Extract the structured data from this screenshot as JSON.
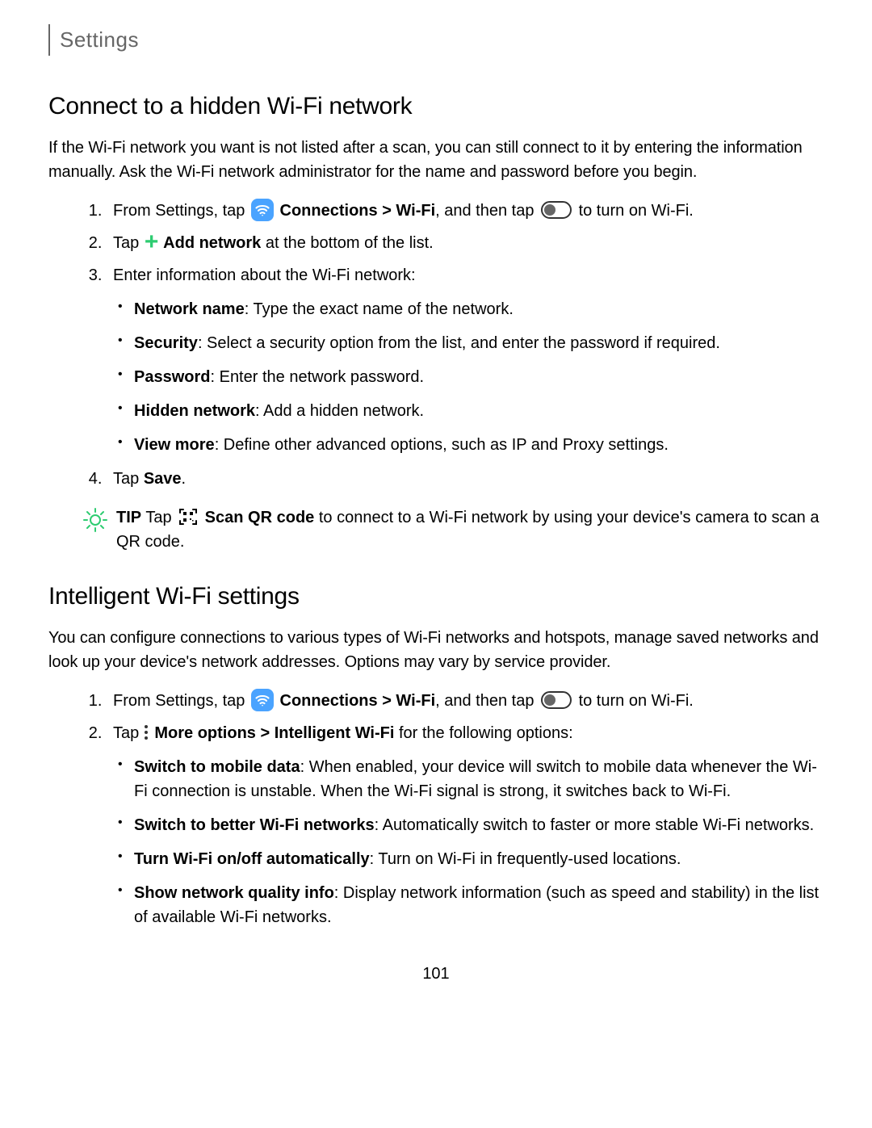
{
  "header": {
    "title": "Settings"
  },
  "section1": {
    "heading": "Connect to a hidden Wi-Fi network",
    "intro": "If the Wi-Fi network you want is not listed after a scan, you can still connect to it by entering the information manually. Ask the Wi-Fi network administrator for the name and password before you begin.",
    "step1_a": "From Settings, tap ",
    "step1_b": " Connections > Wi-Fi",
    "step1_c": ", and then tap ",
    "step1_d": " to turn on Wi-Fi.",
    "step2_a": "Tap ",
    "step2_b": " Add network",
    "step2_c": " at the bottom of the list.",
    "step3": "Enter information about the Wi-Fi network:",
    "bullets": [
      {
        "term": "Network name",
        "desc": ": Type the exact name of the network."
      },
      {
        "term": "Security",
        "desc": ": Select a security option from the list, and enter the password if required."
      },
      {
        "term": "Password",
        "desc": ": Enter the network password."
      },
      {
        "term": "Hidden network",
        "desc": ": Add a hidden network."
      },
      {
        "term": "View more",
        "desc": ": Define other advanced options, such as IP and Proxy settings."
      }
    ],
    "step4_a": "Tap ",
    "step4_b": "Save",
    "step4_c": ".",
    "tip_label": "TIP",
    "tip_a": "  Tap ",
    "tip_b": " Scan QR code",
    "tip_c": " to connect to a Wi-Fi network by using your device's camera to scan a QR code."
  },
  "section2": {
    "heading": "Intelligent Wi-Fi settings",
    "intro": "You can configure connections to various types of Wi-Fi networks and hotspots, manage saved networks and look up your device's network addresses. Options may vary by service provider.",
    "step1_a": "From Settings, tap ",
    "step1_b": " Connections > Wi-Fi",
    "step1_c": ", and then tap ",
    "step1_d": " to turn on Wi-Fi.",
    "step2_a": "Tap ",
    "step2_b": " More options > Intelligent Wi-Fi",
    "step2_c": " for the following options:",
    "bullets": [
      {
        "term": "Switch to mobile data",
        "desc": ": When enabled, your device will switch to mobile data whenever the Wi-Fi connection is unstable. When the Wi-Fi signal is strong, it switches back to Wi-Fi."
      },
      {
        "term": "Switch to better Wi-Fi networks",
        "desc": ": Automatically switch to faster or more stable Wi-Fi networks."
      },
      {
        "term": "Turn Wi-Fi on/off automatically",
        "desc": ": Turn on Wi-Fi in frequently-used locations."
      },
      {
        "term": "Show network quality info",
        "desc": ": Display network information (such as speed and stability) in the list of available Wi-Fi networks."
      }
    ]
  },
  "page_number": "101"
}
